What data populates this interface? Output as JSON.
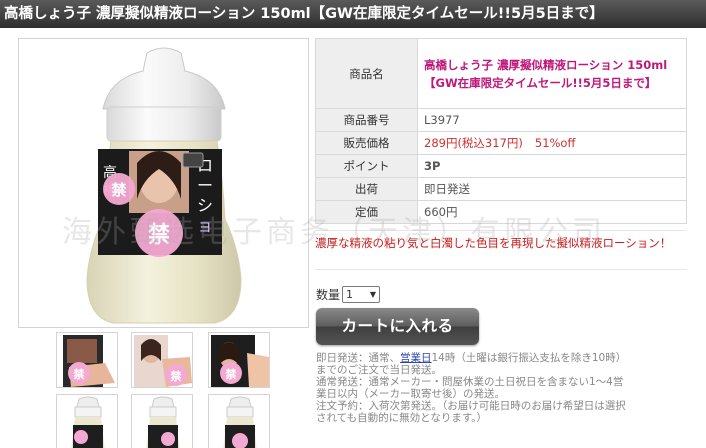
{
  "header": {
    "title": "高橋しょう子 濃厚擬似精液ローション 150ml【GW在庫限定タイムセール!!5月5日まで】"
  },
  "gallery": {
    "main_image": {
      "subject": "lotion-bottle",
      "label_lines": [
        "高橋しょう子",
        "ローション"
      ],
      "censor_mark": "禁"
    },
    "thumbnails": [
      {
        "subject": "package-box",
        "censor_mark": "禁"
      },
      {
        "subject": "package-box-portrait",
        "censor_mark": "禁"
      },
      {
        "subject": "package-box-alt",
        "censor_mark": "禁"
      },
      {
        "subject": "lotion-bottle"
      },
      {
        "subject": "lotion-bottle"
      },
      {
        "subject": "lotion-bottle"
      }
    ]
  },
  "specs": {
    "rows": [
      {
        "key": "商品名",
        "value_line1": "高橋しょう子 濃厚擬似精液ローション 150ml",
        "value_line2": "【GW在庫限定タイムセール!!5月5日まで】"
      },
      {
        "key": "商品番号",
        "value": "L3977"
      },
      {
        "key": "販売価格",
        "price": "289円(税込317円)",
        "discount": "51%off"
      },
      {
        "key": "ポイント",
        "value": "3P"
      },
      {
        "key": "出荷",
        "value": "即日発送"
      },
      {
        "key": "定価",
        "value": "660円"
      }
    ]
  },
  "description": {
    "text": "濃厚な精液の粘り気と白濁した色目を再現した擬似精液ローション！"
  },
  "purchase": {
    "qty_label": "数量",
    "qty_value": "1",
    "cart_button_label": "カートに入れる"
  },
  "shipping": {
    "line1_prefix": "即日発送：通常、",
    "line1_link": "営業日",
    "line1_suffix": "14時（土曜は銀行振込支払を除き10時）",
    "line2": "までのご注文で当日発送。",
    "line3": "通常発送：通常メーカー・問屋休業の土日祝日を含まない1〜4営",
    "line4": "業日以内（メーカー取寄せ後）の発送。",
    "line5": "注文予約：入荷次第発送。（お届け可能日時のお届け希望日は選択",
    "line6": "されても自動的に無効となります。）"
  },
  "watermark": {
    "text": "海外甄选电子商务（天津）有限公司"
  },
  "colors": {
    "title_bar": "#3a3a3a",
    "product_name": "#c0177a",
    "price": "#d22e2e",
    "points": "#1a3ea8",
    "description": "#cc1a1a",
    "censor_pink": "#f4a9d2"
  }
}
